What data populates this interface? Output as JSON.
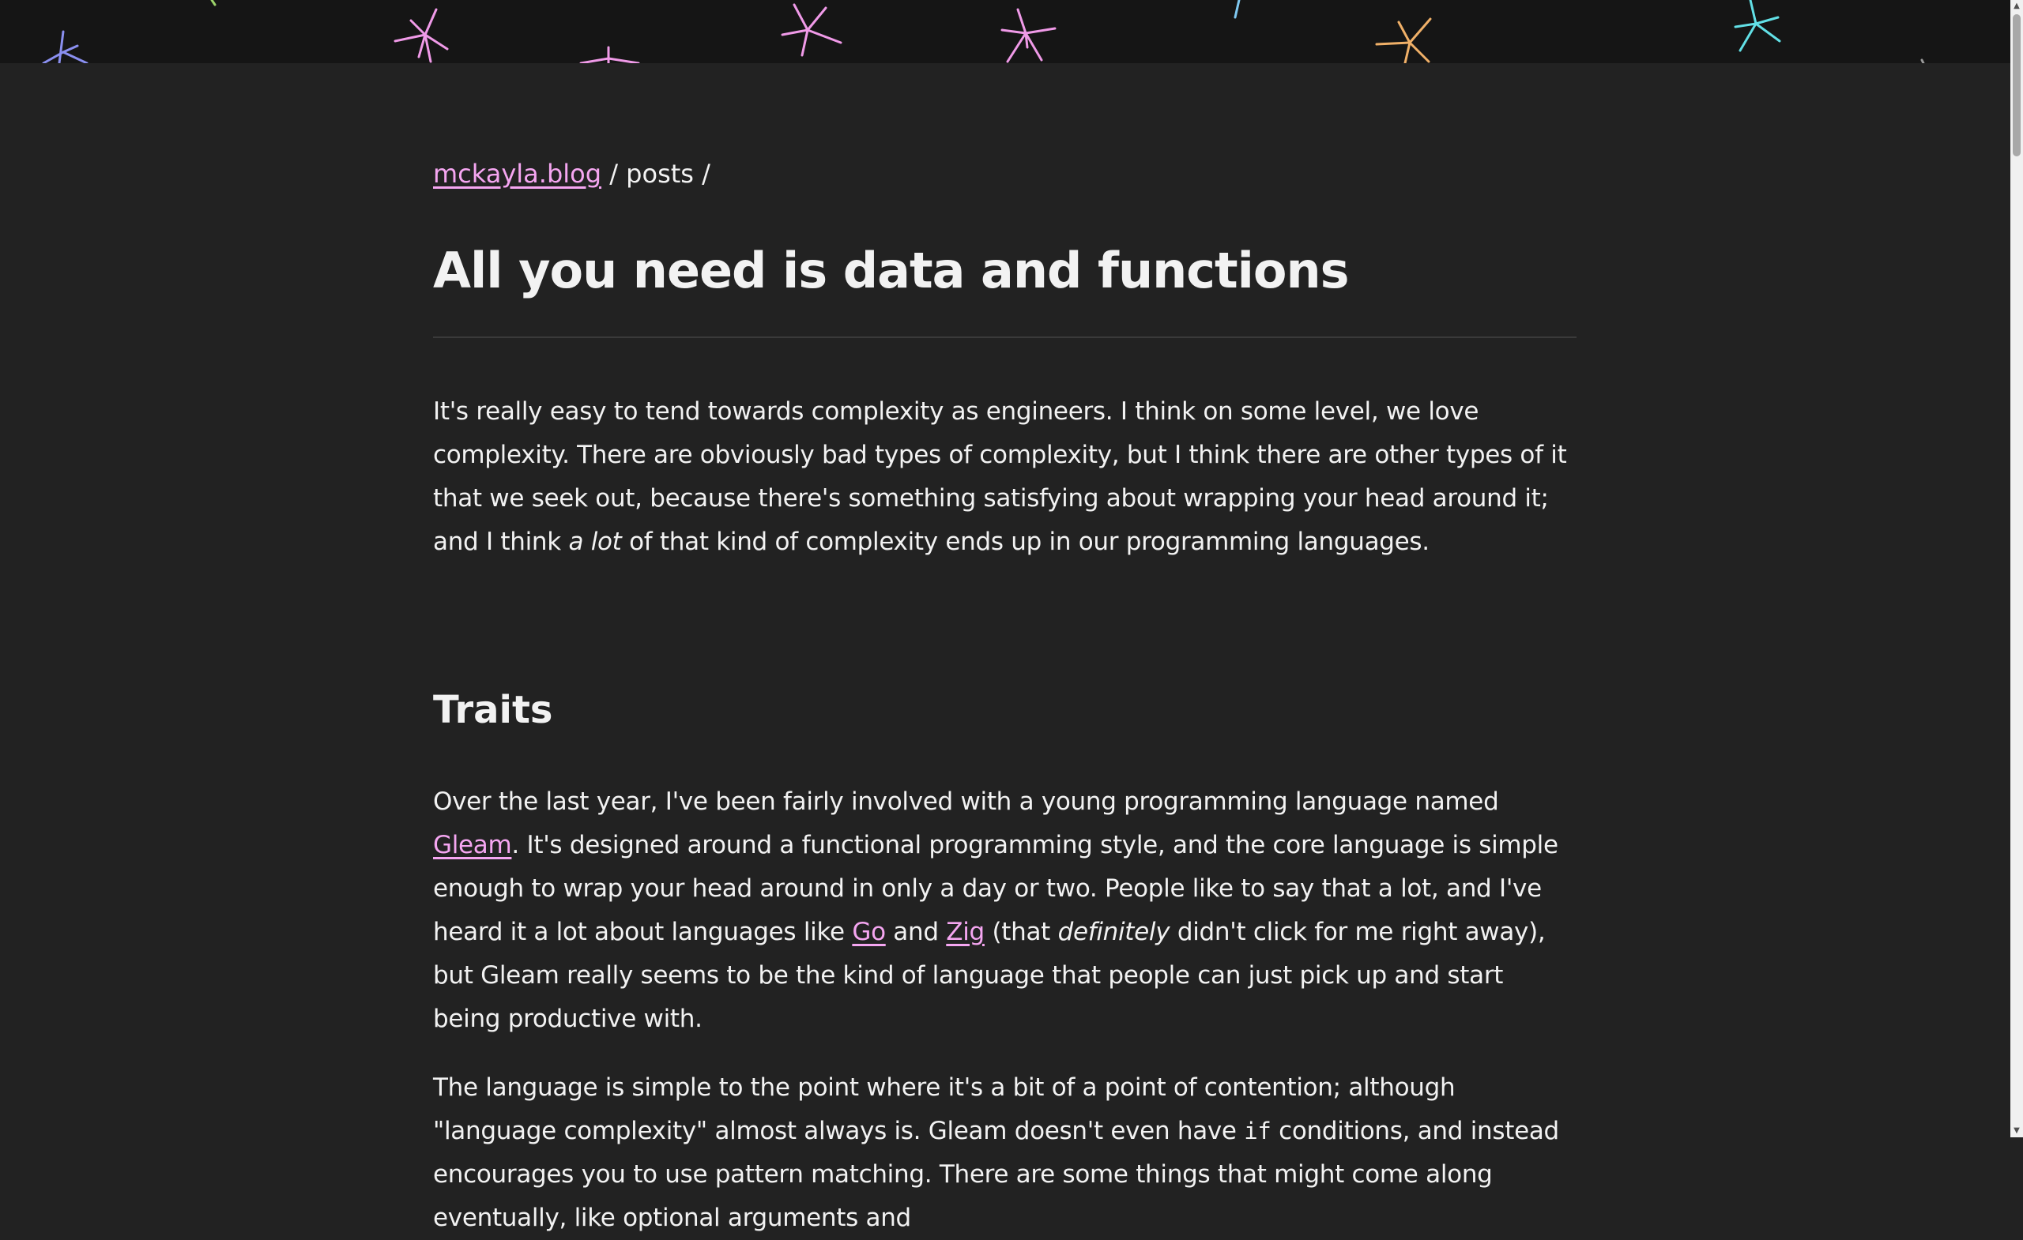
{
  "breadcrumb": {
    "site": "mckayla.blog",
    "separator1": " / ",
    "section": "posts",
    "separator2": " /"
  },
  "title": "All you need is data and functions",
  "intro": {
    "part1": "It's really easy to tend towards complexity as engineers. I think on some level, we love complexity. There are obviously bad types of complexity, but I think there are other types of it that we seek out, because there's something satisfying about wrapping your head around it; and I think ",
    "emphasis": "a lot",
    "part2": " of that kind of complexity ends up in our programming languages."
  },
  "section_heading": "Traits",
  "paragraph2": {
    "part1": "Over the last year, I've been fairly involved with a young programming language named ",
    "link_gleam": "Gleam",
    "part2": ". It's designed around a functional programming style, and the core language is simple enough to wrap your head around in only a day or two. People like to say that a lot, and I've heard it a lot about languages like ",
    "link_go": "Go",
    "part3": " and ",
    "link_zig": "Zig",
    "part4": " (that ",
    "emphasis": "definitely",
    "part5": " didn't click for me right away), but Gleam really seems to be the kind of language that people can just pick up and start being productive with."
  },
  "paragraph3": {
    "part1": "The language is simple to the point where it's a bit of a point of contention; although \"language complexity\" almost always is. Gleam doesn't even have ",
    "code": "if",
    "part2": " conditions, and instead encourages you to use pattern matching. There are some things that might come along eventually, like optional arguments and"
  },
  "colors": {
    "background": "#222222",
    "header": "#151515",
    "link": "#f5a6f1",
    "text": "#f2f2f2"
  }
}
